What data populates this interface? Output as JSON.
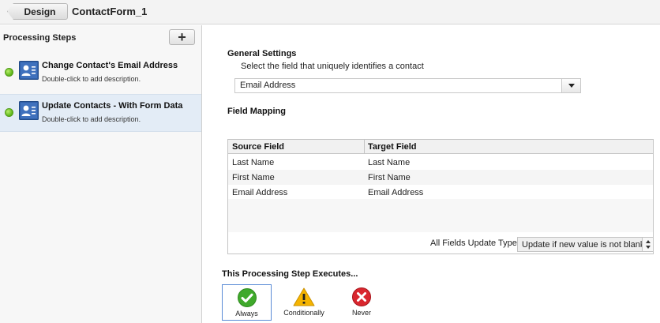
{
  "header": {
    "design_label": "Design",
    "form_name": "ContactForm_1"
  },
  "sidebar": {
    "title": "Processing Steps",
    "add_label": "+",
    "steps": [
      {
        "name": "Change Contact's Email Address",
        "description": "Double-click to add description.",
        "status": "active",
        "selected": false
      },
      {
        "name": "Update Contacts - With Form Data",
        "description": "Double-click to add description.",
        "status": "active",
        "selected": true
      }
    ]
  },
  "general_settings": {
    "title": "General Settings",
    "label": "Select the field that uniquely identifies a contact",
    "selected_value": "Email Address"
  },
  "field_mapping": {
    "title": "Field Mapping",
    "columns": [
      "Source Field",
      "Target Field"
    ],
    "rows": [
      [
        "Last Name",
        "Last Name"
      ],
      [
        "First Name",
        "First Name"
      ],
      [
        "Email Address",
        "Email Address"
      ]
    ],
    "update_type_label": "All Fields Update Type",
    "update_type_value": "Update if new value is not blank"
  },
  "execution": {
    "title": "This Processing Step Executes...",
    "options": [
      {
        "label": "Always",
        "selected": true
      },
      {
        "label": "Conditionally",
        "selected": false
      },
      {
        "label": "Never",
        "selected": false
      }
    ]
  },
  "colors": {
    "accent": "#5a8bd6",
    "selected_row": "#e3ecf6",
    "status_green": "#62b91c",
    "check_green": "#3fa92b",
    "warning_yellow": "#f5b400",
    "never_red": "#d9262e"
  }
}
